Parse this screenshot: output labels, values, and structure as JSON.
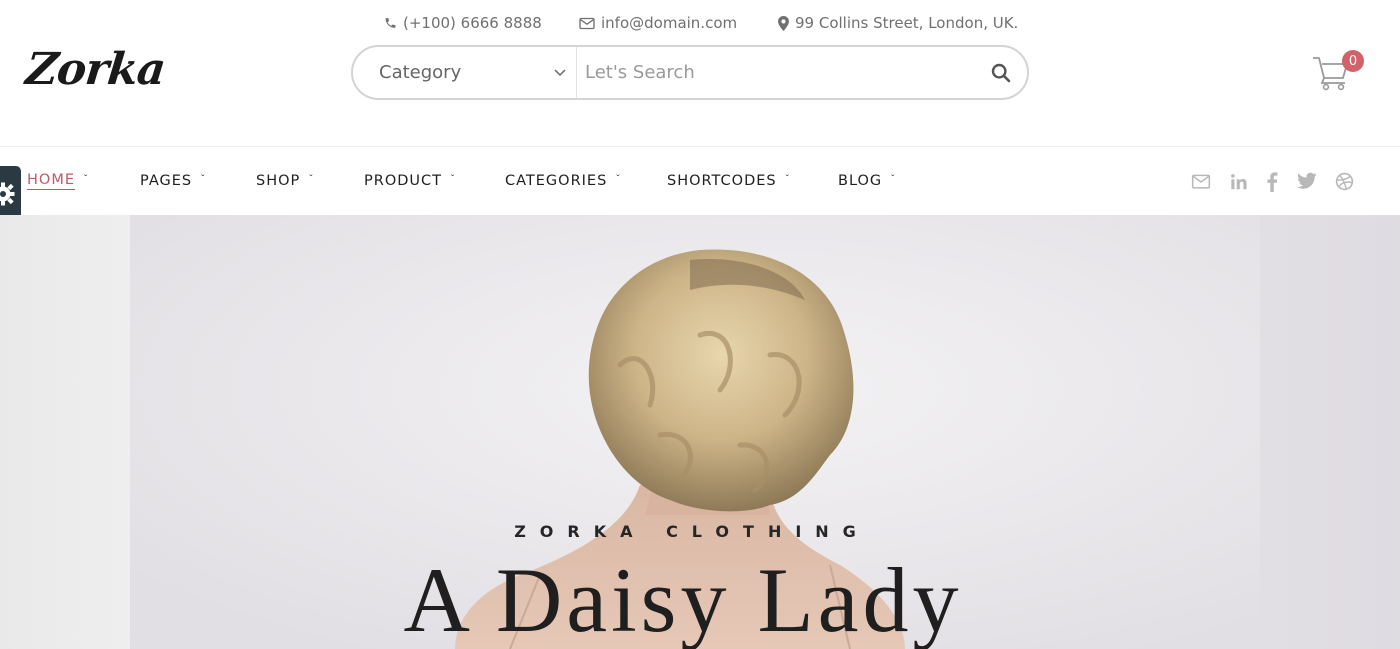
{
  "header": {
    "phone": "(+100) 6666 8888",
    "email": "info@domain.com",
    "address": "99 Collins Street, London, UK.",
    "phone_icon": "phone-icon",
    "email_icon": "envelope-icon",
    "address_icon": "map-marker-icon"
  },
  "logo": {
    "text": "Zorka"
  },
  "search": {
    "category_label": "Category",
    "placeholder": "Let's Search",
    "chevron_icon": "chevron-down-icon",
    "button_icon": "search-icon"
  },
  "cart": {
    "count": "0",
    "icon": "cart-icon",
    "badge_color": "#d2616a"
  },
  "nav": {
    "items": [
      {
        "label": "HOME",
        "active": true
      },
      {
        "label": "PAGES"
      },
      {
        "label": "SHOP"
      },
      {
        "label": "PRODUCT"
      },
      {
        "label": "CATEGORIES"
      },
      {
        "label": "SHORTCODES"
      },
      {
        "label": "BLOG"
      }
    ],
    "caret": "ˇ",
    "active_color": "#c65766"
  },
  "social": [
    "envelope-icon",
    "linkedin-icon",
    "facebook-icon",
    "twitter-icon",
    "dribbble-icon"
  ],
  "settings_tab": {
    "icon": "gear-icon",
    "color": "#2b3a42"
  },
  "hero": {
    "eyebrow": "ZORKA CLOTHING",
    "title": "A Daisy Lady"
  }
}
